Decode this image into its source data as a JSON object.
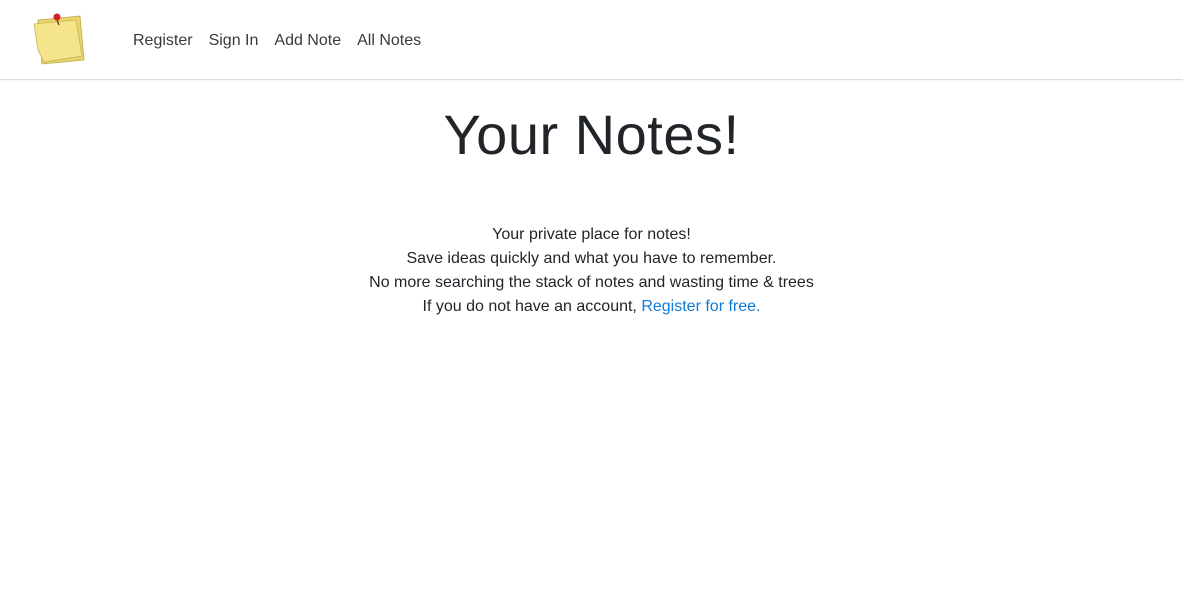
{
  "nav": {
    "logo_icon": "sticky-note-icon",
    "items": [
      {
        "label": "Register"
      },
      {
        "label": "Sign In"
      },
      {
        "label": "Add Note"
      },
      {
        "label": "All Notes"
      }
    ]
  },
  "main": {
    "title": "Your Notes!",
    "lines": [
      "Your private place for notes!",
      "Save ideas quickly and what you have to remember.",
      "No more searching the stack of notes and wasting time & trees"
    ],
    "cta_prefix": "If you do not have an account, ",
    "cta_link": "Register for free."
  },
  "colors": {
    "link": "#0f7bd8",
    "note_yellow": "#f3e27c",
    "pin_red": "#d0202a"
  }
}
